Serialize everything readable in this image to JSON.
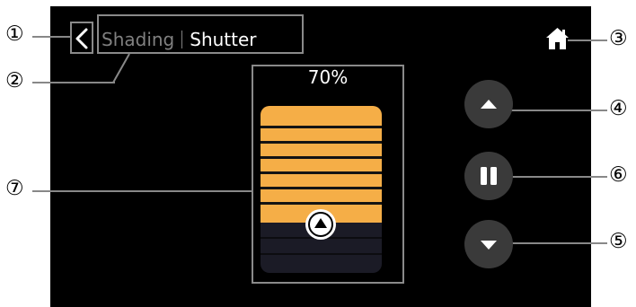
{
  "header": {
    "title_left": "Shading",
    "title_right": "Shutter"
  },
  "shutter": {
    "percent_label": "70%",
    "open_level": 0.7
  },
  "callouts": {
    "c1": "①",
    "c2": "②",
    "c3": "③",
    "c4": "④",
    "c5": "⑤",
    "c6": "⑥",
    "c7": "⑦"
  },
  "icons": {
    "back": "back-chevron-icon",
    "home": "home-icon",
    "up": "up-triangle-icon",
    "pause": "pause-icon",
    "down": "down-triangle-icon",
    "knob": "knob-up-icon"
  },
  "colors": {
    "accent": "#f5ae47",
    "screen_bg": "#000000",
    "button_bg": "#3a3a3a",
    "dim_text": "#808080"
  }
}
